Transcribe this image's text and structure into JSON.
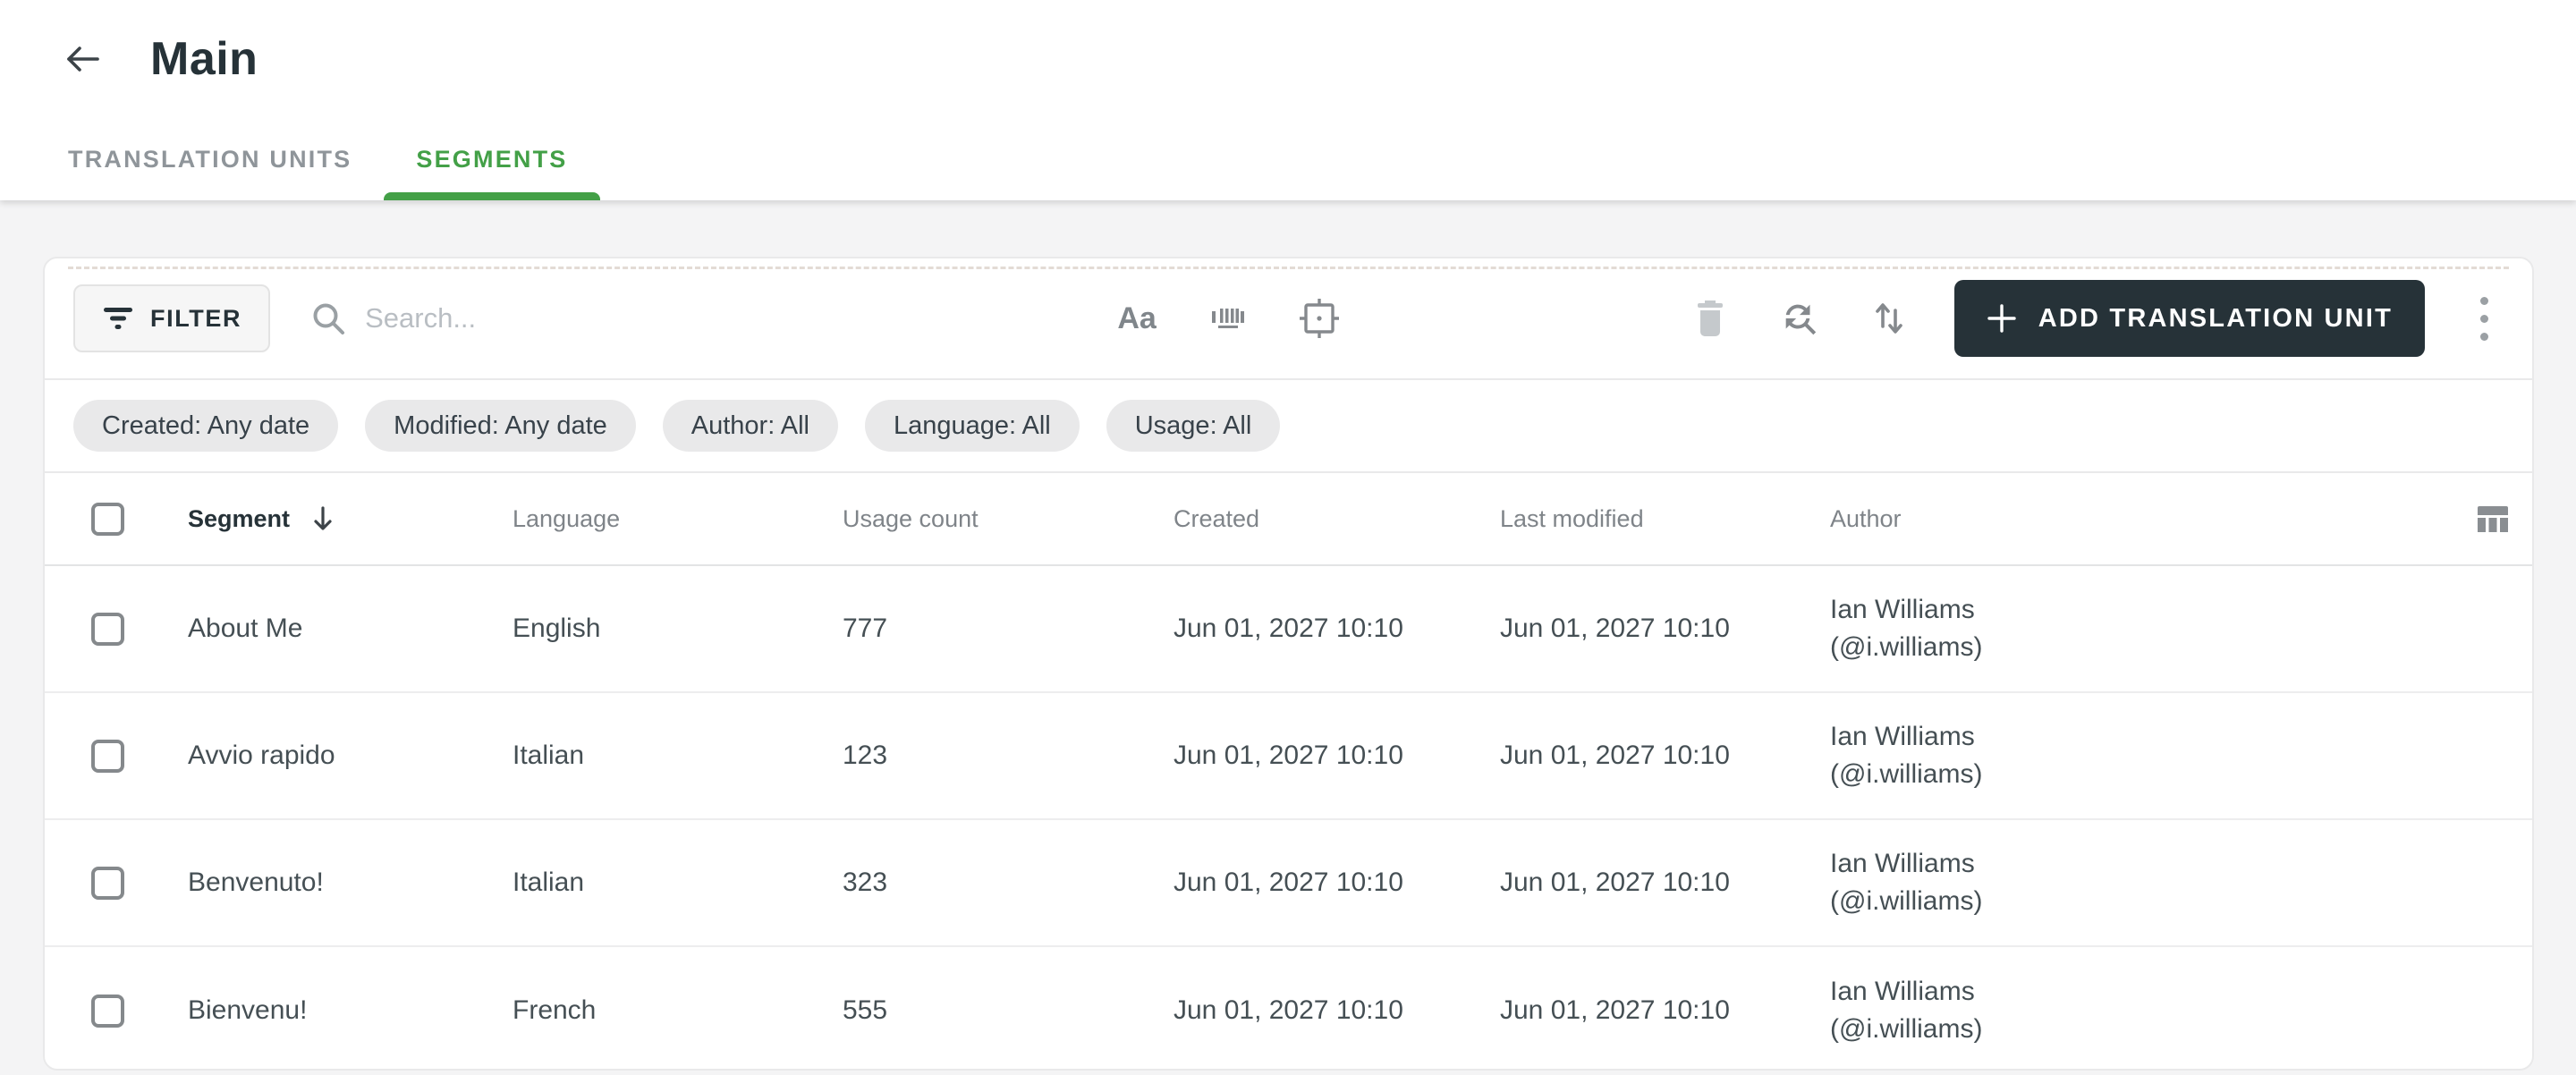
{
  "colors": {
    "accent_green": "#43A047",
    "dark_navy": "#263238",
    "page_bg": "#f4f4f5",
    "chip_bg": "#e9e9ea",
    "disabled_icon": "#c5c9cc",
    "icon_gray": "#85898d"
  },
  "header": {
    "title": "Main"
  },
  "tabs": [
    {
      "label": "TRANSLATION UNITS",
      "active": false
    },
    {
      "label": "SEGMENTS",
      "active": true
    }
  ],
  "toolbar": {
    "filter_label": "FILTER",
    "search_placeholder": "Search...",
    "add_label": "ADD TRANSLATION UNIT"
  },
  "icons": {
    "match_case": "Aa",
    "back": "arrow-left",
    "search": "magnifier",
    "whole_word": "barcode",
    "selection": "focus-frame-dot",
    "delete": "trash",
    "find_replace": "circular-arrows-magnifier",
    "sort": "up-down-arrows",
    "more": "kebab-vertical",
    "column_settings": "table-columns",
    "sort_desc": "arrow-down"
  },
  "filter_chips": [
    "Created: Any date",
    "Modified: Any date",
    "Author: All",
    "Language: All",
    "Usage: All"
  ],
  "table": {
    "columns": [
      "Segment",
      "Language",
      "Usage count",
      "Created",
      "Last modified",
      "Author"
    ],
    "rows": [
      {
        "segment": "About Me",
        "language": "English",
        "usage_count": "777",
        "created": "Jun 01, 2027 10:10",
        "last_modified": "Jun 01, 2027 10:10",
        "author_name": "Ian Williams",
        "author_handle": "(@i.williams)"
      },
      {
        "segment": "Avvio rapido",
        "language": "Italian",
        "usage_count": "123",
        "created": "Jun 01, 2027 10:10",
        "last_modified": "Jun 01, 2027 10:10",
        "author_name": "Ian Williams",
        "author_handle": "(@i.williams)"
      },
      {
        "segment": "Benvenuto!",
        "language": "Italian",
        "usage_count": "323",
        "created": "Jun 01, 2027 10:10",
        "last_modified": "Jun 01, 2027 10:10",
        "author_name": "Ian Williams",
        "author_handle": "(@i.williams)"
      },
      {
        "segment": "Bienvenu!",
        "language": "French",
        "usage_count": "555",
        "created": "Jun 01, 2027 10:10",
        "last_modified": "Jun 01, 2027 10:10",
        "author_name": "Ian Williams",
        "author_handle": "(@i.williams)"
      }
    ]
  }
}
